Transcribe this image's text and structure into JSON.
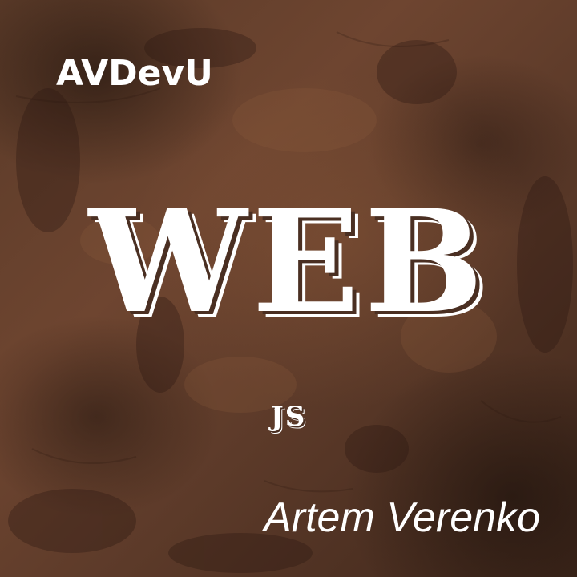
{
  "cover": {
    "brand": "AVDevU",
    "title": "WEB",
    "subtitle": "JS",
    "author": "Artem Verenko"
  },
  "colors": {
    "background": "#5a3a28",
    "text": "#ffffff"
  }
}
